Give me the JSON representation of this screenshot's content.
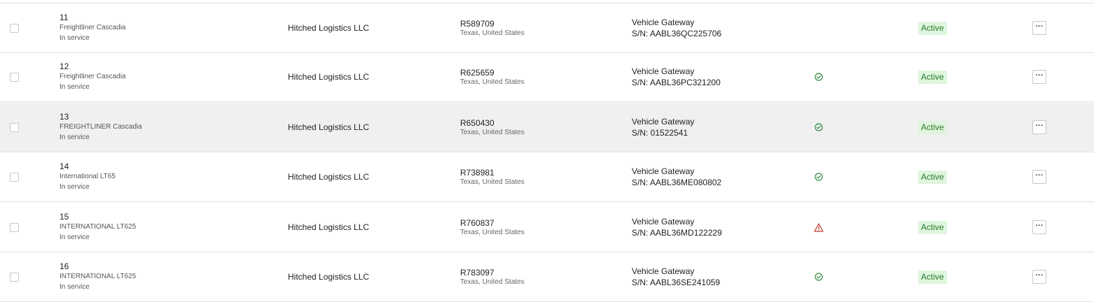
{
  "colors": {
    "status_badge_bg": "#dff5dd",
    "status_badge_text": "#2c7a2e",
    "ok_icon": "#2e8b3e",
    "warning_icon": "#c0392b",
    "highlight_row": "#f0f0f0"
  },
  "rows": [
    {
      "unit": "11",
      "model": "Freightliner Cascadia",
      "service": "In service",
      "company": "Hitched Logistics LLC",
      "plate": "R589709",
      "location": "Texas, United States",
      "gateway": "Vehicle Gateway",
      "serial": "S/N: AABL36QC225706",
      "health": "none",
      "status": "Active"
    },
    {
      "unit": "12",
      "model": "Freightliner Cascadia",
      "service": "In service",
      "company": "Hitched Logistics LLC",
      "plate": "R625659",
      "location": "Texas, United States",
      "gateway": "Vehicle Gateway",
      "serial": "S/N: AABL36PC321200",
      "health": "check-circle-icon",
      "status": "Active"
    },
    {
      "unit": "13",
      "model": "FREIGHTLINER Cascadia",
      "service": "In service",
      "company": "Hitched Logistics LLC",
      "plate": "R650430",
      "location": "Texas, United States",
      "gateway": "Vehicle Gateway",
      "serial": "S/N: 01522541",
      "health": "check-circle-icon",
      "status": "Active"
    },
    {
      "unit": "14",
      "model": "International LT65",
      "service": "In service",
      "company": "Hitched Logistics LLC",
      "plate": "R738981",
      "location": "Texas, United States",
      "gateway": "Vehicle Gateway",
      "serial": "S/N: AABL36ME080802",
      "health": "check-circle-icon",
      "status": "Active"
    },
    {
      "unit": "15",
      "model": "INTERNATIONAL LT625",
      "service": "In service",
      "company": "Hitched Logistics LLC",
      "plate": "R760837",
      "location": "Texas, United States",
      "gateway": "Vehicle Gateway",
      "serial": "S/N: AABL36MD122229",
      "health": "warning-triangle-icon",
      "status": "Active"
    },
    {
      "unit": "16",
      "model": "INTERNATIONAL LT625",
      "service": "In service",
      "company": "Hitched Logistics LLC",
      "plate": "R783097",
      "location": "Texas, United States",
      "gateway": "Vehicle Gateway",
      "serial": "S/N: AABL36SE241059",
      "health": "check-circle-icon",
      "status": "Active"
    }
  ],
  "more_button_label": "···"
}
